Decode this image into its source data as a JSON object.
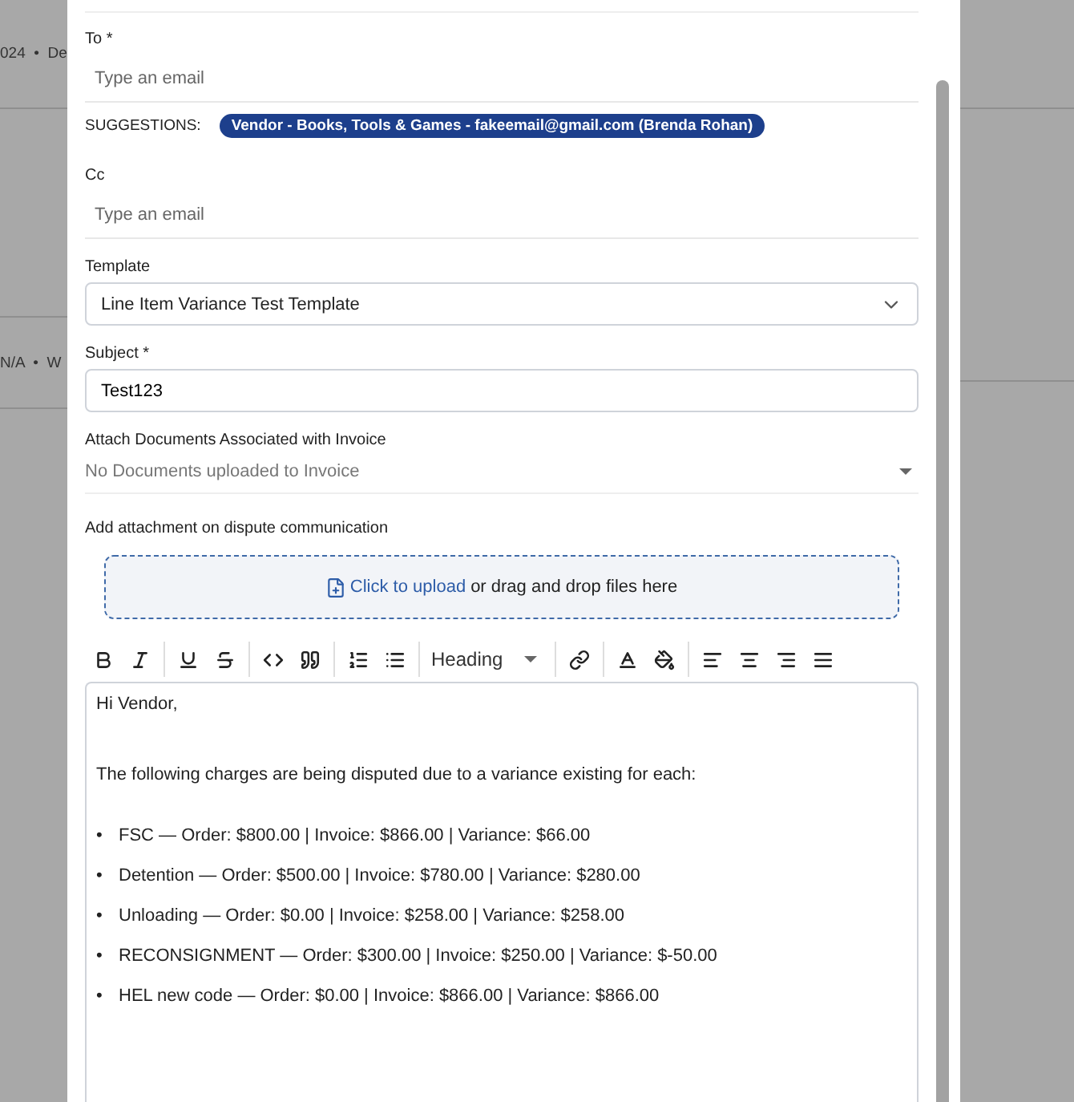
{
  "background": {
    "fragments": [
      "024  •  De",
      "N/A  •  W"
    ]
  },
  "form": {
    "to": {
      "label": "To *",
      "placeholder": "Type an email"
    },
    "suggestions": {
      "label": "SUGGESTIONS:",
      "items": [
        "Vendor - Books, Tools & Games - fakeemail@gmail.com (Brenda Rohan)"
      ]
    },
    "cc": {
      "label": "Cc",
      "placeholder": "Type an email"
    },
    "template": {
      "label": "Template",
      "value": "Line Item Variance Test Template"
    },
    "subject": {
      "label": "Subject *",
      "value": "Test123"
    },
    "attach_documents": {
      "label": "Attach Documents Associated with Invoice",
      "placeholder": "No Documents uploaded to Invoice"
    },
    "attachment": {
      "label": "Add attachment on dispute communication",
      "link": "Click to upload",
      "text": "or drag and drop files here"
    },
    "toolbar": {
      "heading": "Heading"
    },
    "editor": {
      "greeting": "Hi Vendor,",
      "intro": "The following charges are being disputed due to a variance existing for each:",
      "marker": "•",
      "bullets": [
        "FSC — Order: $800.00 | Invoice: $866.00 | Variance: $66.00",
        "Detention — Order: $500.00 | Invoice: $780.00 | Variance: $280.00",
        "Unloading — Order: $0.00 | Invoice: $258.00 | Variance: $258.00",
        "RECONSIGNMENT — Order: $300.00 | Invoice: $250.00 | Variance: $-50.00",
        "HEL new code — Order: $0.00 | Invoice: $866.00 | Variance: $866.00"
      ]
    }
  }
}
